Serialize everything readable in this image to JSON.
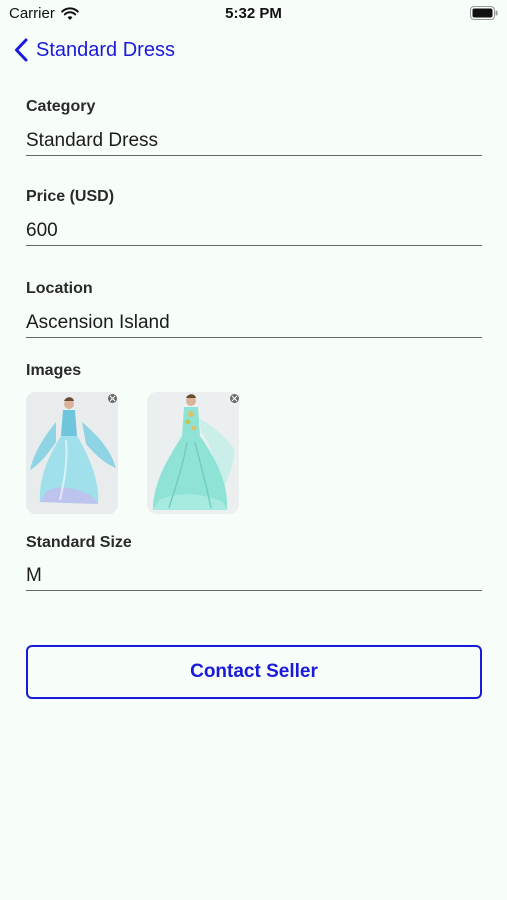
{
  "status_bar": {
    "carrier": "Carrier",
    "time": "5:32 PM",
    "wifi_icon": "wifi-icon",
    "battery_icon": "battery-icon"
  },
  "nav": {
    "back_icon": "chevron-left-icon",
    "title": "Standard Dress"
  },
  "fields": {
    "category": {
      "label": "Category",
      "value": "Standard Dress"
    },
    "price": {
      "label": "Price (USD)",
      "value": "600"
    },
    "location": {
      "label": "Location",
      "value": "Ascension Island"
    },
    "images": {
      "label": "Images",
      "count": 2
    },
    "size": {
      "label": "Standard Size",
      "value": "M"
    }
  },
  "actions": {
    "contact_label": "Contact Seller"
  },
  "colors": {
    "accent": "#1a1adb",
    "background": "#f7fdf8",
    "dress": "#8ee3d6"
  }
}
